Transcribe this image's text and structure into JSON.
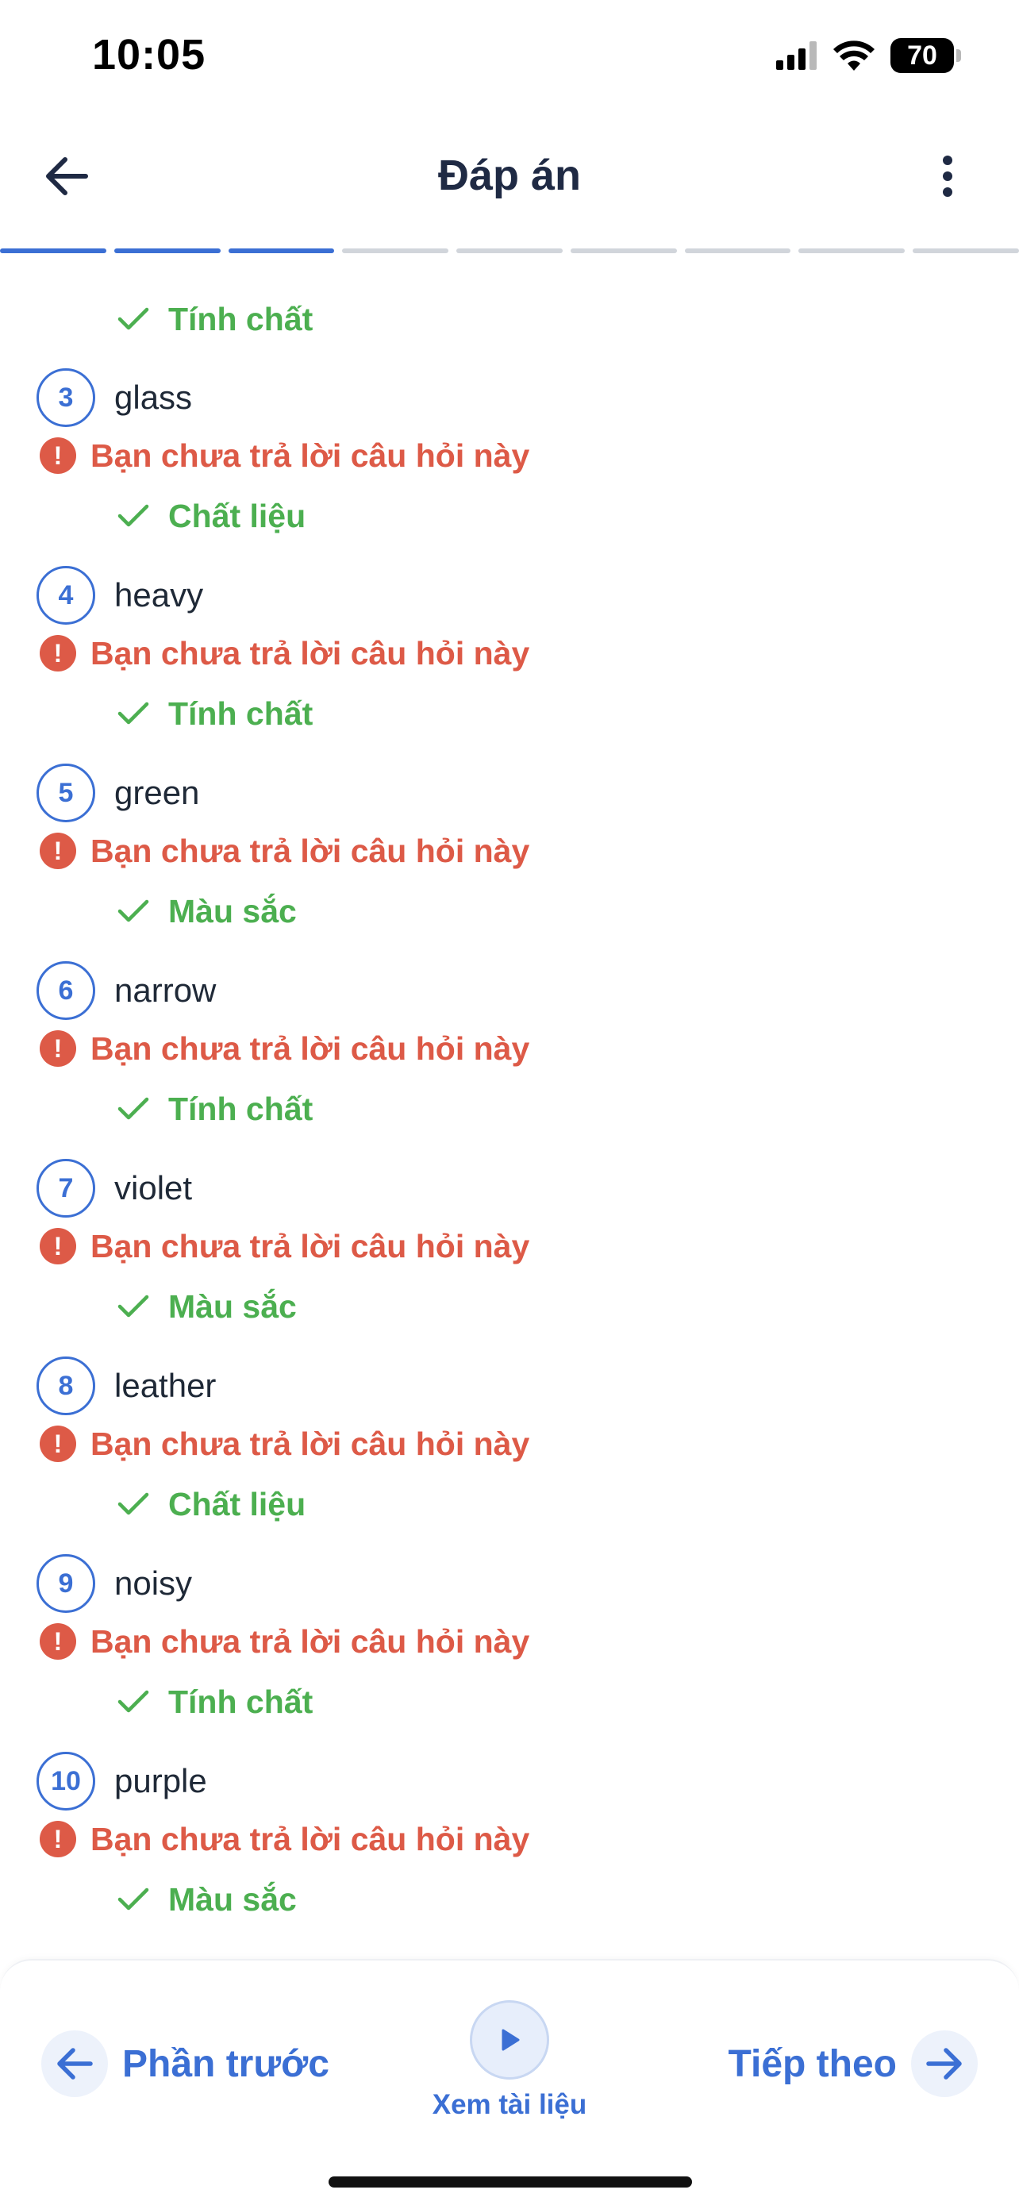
{
  "status_bar": {
    "time": "10:05",
    "battery": "70"
  },
  "header": {
    "title": "Đáp án"
  },
  "progress": {
    "total_segments": 9,
    "active_segments": 3
  },
  "first_answer": {
    "text": "Tính chất"
  },
  "questions": [
    {
      "number": "3",
      "word": "glass",
      "status": "Bạn chưa trả lời câu hỏi này",
      "answer": "Chất liệu"
    },
    {
      "number": "4",
      "word": "heavy",
      "status": "Bạn chưa trả lời câu hỏi này",
      "answer": "Tính chất"
    },
    {
      "number": "5",
      "word": "green",
      "status": "Bạn chưa trả lời câu hỏi này",
      "answer": "Màu sắc"
    },
    {
      "number": "6",
      "word": "narrow",
      "status": "Bạn chưa trả lời câu hỏi này",
      "answer": "Tính chất"
    },
    {
      "number": "7",
      "word": "violet",
      "status": "Bạn chưa trả lời câu hỏi này",
      "answer": "Màu sắc"
    },
    {
      "number": "8",
      "word": "leather",
      "status": "Bạn chưa trả lời câu hỏi này",
      "answer": "Chất liệu"
    },
    {
      "number": "9",
      "word": "noisy",
      "status": "Bạn chưa trả lời câu hỏi này",
      "answer": "Tính chất"
    },
    {
      "number": "10",
      "word": "purple",
      "status": "Bạn chưa trả lời câu hỏi này",
      "answer": "Màu sắc"
    }
  ],
  "bottom_bar": {
    "prev_label": "Phần trước",
    "doc_label": "Xem tài liệu",
    "next_label": "Tiếp theo"
  },
  "colors": {
    "accent": "#3b6fd4",
    "error": "#dd5a47",
    "correct": "#4caf50"
  },
  "icons": {
    "back": "arrow-left-icon",
    "more": "more-vertical-icon",
    "error": "exclamation-circle-icon",
    "correct": "check-icon",
    "prev": "arrow-left-icon",
    "play": "play-icon",
    "next": "arrow-right-icon"
  }
}
